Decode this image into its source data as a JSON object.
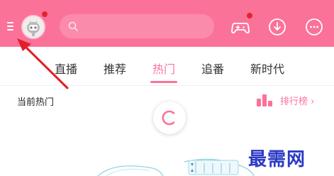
{
  "header": {
    "background_color": "#fb7299",
    "menu_icon": "hamburger-icon",
    "avatar_icon": "avatar-robot-icon",
    "search_icon": "search-icon",
    "search_placeholder": "",
    "actions": [
      {
        "name": "game-center-button",
        "icon": "gamepad-icon",
        "has_badge": true
      },
      {
        "name": "download-button",
        "icon": "download-icon",
        "has_badge": false
      },
      {
        "name": "messages-button",
        "icon": "chat-bubble-icon",
        "has_badge": false
      }
    ]
  },
  "tabs": [
    {
      "label": "直播"
    },
    {
      "label": "推荐"
    },
    {
      "label": "热门",
      "active": true
    },
    {
      "label": "追番"
    },
    {
      "label": "新时代"
    }
  ],
  "section": {
    "title": "当前热门",
    "ranking_label": "排行榜",
    "ranking_icon": "bar-chart-icon",
    "chevron": "›"
  },
  "loading_icon": "loading-spinner-icon",
  "watermark": "最需网",
  "annotation": {
    "type": "arrow",
    "color": "#e0202a",
    "points_to": "hamburger-icon"
  },
  "colors": {
    "accent": "#fb7299",
    "badge": "#e4242b",
    "watermark": "#2b3ac4"
  }
}
